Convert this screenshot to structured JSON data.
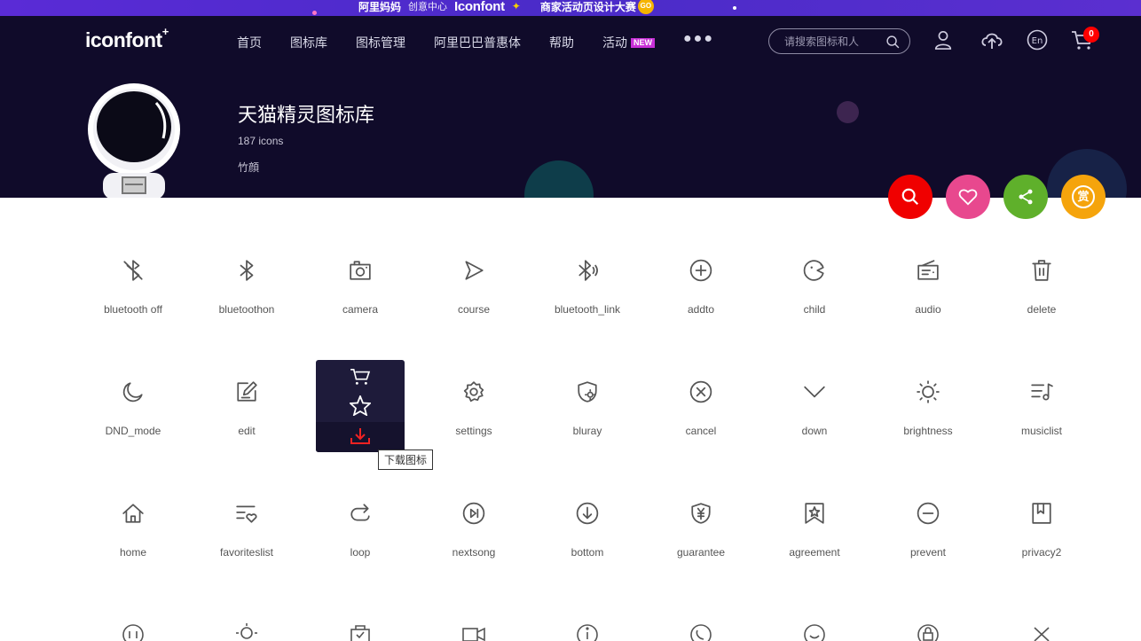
{
  "banner": {
    "brand": "阿里妈妈",
    "sub": "创意中心",
    "logo": "Iconfont",
    "event": "商家活动页设计大赛",
    "go": "GO"
  },
  "header": {
    "logo": "iconfont",
    "nav": [
      "首页",
      "图标库",
      "图标管理",
      "阿里巴巴普惠体",
      "帮助",
      "活动"
    ],
    "new_badge": "NEW",
    "search_placeholder": "请搜索图标和人",
    "cart_count": "0"
  },
  "library": {
    "title": "天猫精灵图标库",
    "count": "187 icons",
    "author": "竹顔"
  },
  "actions": {
    "search_color": "#f00000",
    "like_color": "#e8488e",
    "share_color": "#5fb02b",
    "reward_color": "#f5a40c",
    "reward_label": "赏"
  },
  "icons": [
    {
      "name": "bluetooth off",
      "icon": "bluetooth-off-icon"
    },
    {
      "name": "bluetoothon",
      "icon": "bluetooth-icon"
    },
    {
      "name": "camera",
      "icon": "camera-icon"
    },
    {
      "name": "course",
      "icon": "play-outline-icon"
    },
    {
      "name": "bluetooth_link",
      "icon": "bluetooth-link-icon"
    },
    {
      "name": "addto",
      "icon": "plus-circle-icon"
    },
    {
      "name": "child",
      "icon": "child-icon"
    },
    {
      "name": "audio",
      "icon": "radio-icon"
    },
    {
      "name": "delete",
      "icon": "trash-icon"
    },
    {
      "name": "DND_mode",
      "icon": "moon-icon"
    },
    {
      "name": "edit",
      "icon": "edit-icon"
    },
    {
      "name": "",
      "icon": "hidden-icon"
    },
    {
      "name": "settings",
      "icon": "gear-icon"
    },
    {
      "name": "bluray",
      "icon": "shield-sun-icon"
    },
    {
      "name": "cancel",
      "icon": "x-circle-icon"
    },
    {
      "name": "down",
      "icon": "chevron-down-icon"
    },
    {
      "name": "brightness",
      "icon": "sun-icon"
    },
    {
      "name": "musiclist",
      "icon": "music-list-icon"
    },
    {
      "name": "home",
      "icon": "home-icon"
    },
    {
      "name": "favoriteslist",
      "icon": "heart-list-icon"
    },
    {
      "name": "loop",
      "icon": "loop-icon"
    },
    {
      "name": "nextsong",
      "icon": "next-song-icon"
    },
    {
      "name": "bottom",
      "icon": "arrow-down-circle-icon"
    },
    {
      "name": "guarantee",
      "icon": "yen-shield-icon"
    },
    {
      "name": "agreement",
      "icon": "star-bookmark-icon"
    },
    {
      "name": "prevent",
      "icon": "minus-circle-icon"
    },
    {
      "name": "privacy2",
      "icon": "bookmark-icon"
    }
  ],
  "hover": {
    "tooltip": "下载图标"
  }
}
